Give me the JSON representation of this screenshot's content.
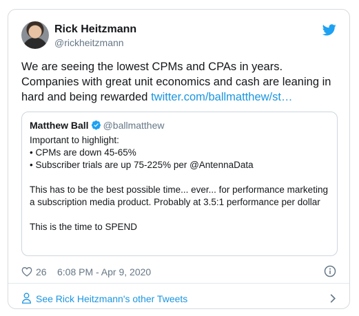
{
  "author": {
    "display_name": "Rick Heitzmann",
    "handle": "@rickheitzmann"
  },
  "tweet": {
    "text": "We are seeing the lowest CPMs and CPAs in years.  Companies with great unit economics and cash are leaning in hard and being rewarded ",
    "link": "twitter.com/ballmatthew/st…"
  },
  "quoted": {
    "display_name": "Matthew Ball",
    "handle": "@ballmatthew",
    "body": "Important to highlight:\n• CPMs are down 45-65%\n• Subscriber trials are up 75-225% per @AntennaData\n\nThis has to be the best possible time... ever... for performance marketing a subscription media product. Probably at 3.5:1 performance per dollar\n\nThis is the time to SPEND"
  },
  "meta": {
    "likes": "26",
    "timestamp": "6:08 PM - Apr 9, 2020"
  },
  "footer": {
    "link_text": "See Rick Heitzmann's other Tweets"
  },
  "colors": {
    "accent": "#1b95e0",
    "secondary_text": "#657786",
    "border": "#ccd6dd"
  },
  "icons": {
    "brand": "twitter-bird-icon",
    "verified": "verified-badge-icon",
    "like": "heart-icon",
    "info": "info-icon",
    "profile": "person-icon",
    "more": "chevron-right-icon"
  }
}
